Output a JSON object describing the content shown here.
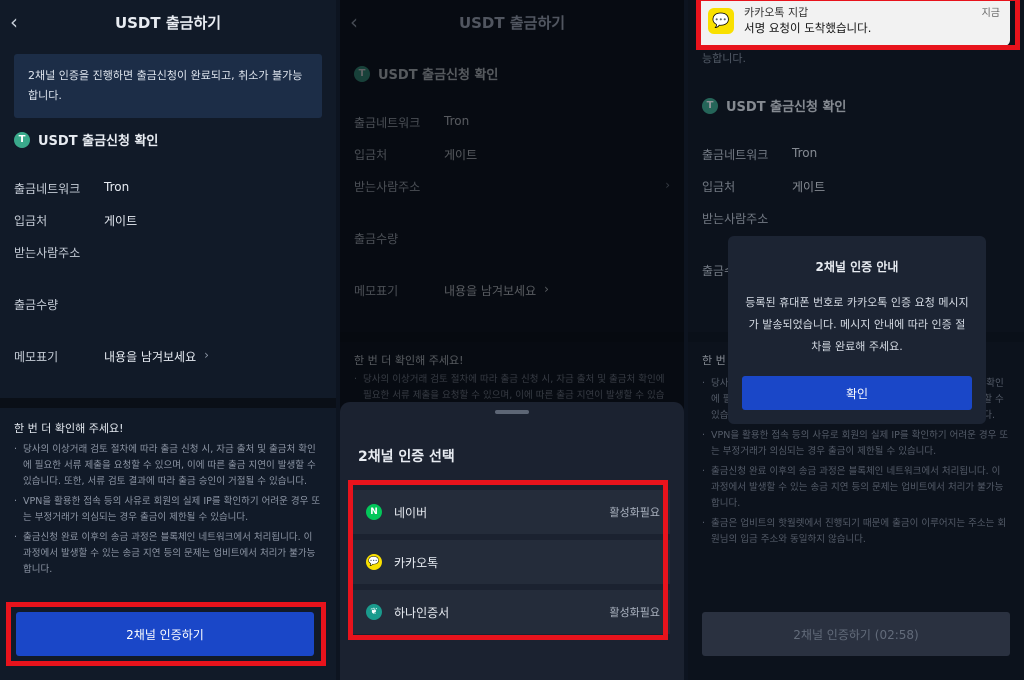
{
  "header": {
    "title": "USDT 출금하기",
    "back": "‹"
  },
  "notice": "2채널 인증을 진행하면 출금신청이 완료되고, 취소가 불가능합니다.",
  "notice_partial": "능합니다.",
  "section_title": "USDT 출금신청 확인",
  "token_symbol": "T",
  "fields": {
    "network_label": "출금네트워크",
    "network_value": "Tron",
    "dest_label": "입금처",
    "dest_value": "게이트",
    "address_label": "받는사람주소",
    "amount_label": "출금수량",
    "memo_label": "메모표기",
    "memo_value": "내용을 남겨보세요",
    "chevron": "›"
  },
  "check_title": "한 번 더 확인해 주세요!",
  "check_items": [
    "당사의 이상거래 검토 절차에 따라 출금 신청 시, 자금 출처 및 출금처 확인에 필요한 서류 제출을 요청할 수 있으며, 이에 따른 출금 지연이 발생할 수 있습니다. 또한, 서류 검토 결과에 따라 출금 승인이 거절될 수 있습니다.",
    "VPN을 활용한 접속 등의 사유로 회원의 실제 IP를 확인하기 어려운 경우 또는 부정거래가 의심되는 경우 출금이 제한될 수 있습니다.",
    "출금신청 완료 이후의 송금 과정은 블록체인 네트워크에서 처리됩니다. 이 과정에서 발생할 수 있는 송금 지연 등의 문제는 업비트에서 처리가 불가능합니다.",
    "출금은 업비트의 핫월렛에서 진행되기 때문에 출금이 이루어지는 주소는 회원님의 입금 주소와 동일하지 않습니다."
  ],
  "check_partial": "한 번",
  "p1_button": "2채널 인증하기",
  "sheet": {
    "title": "2채널 인증 선택",
    "options": [
      {
        "name": "네이버",
        "status": "활성화필요",
        "icon": "N",
        "color": "#03c75a"
      },
      {
        "name": "카카오톡",
        "status": "",
        "icon": "💬",
        "color": "#f9e000"
      },
      {
        "name": "하나인증서",
        "status": "활성화필요",
        "icon": "❦",
        "color": "#1a9b8d"
      }
    ]
  },
  "notification": {
    "title": "카카오톡 지갑",
    "message": "서명 요청이 도착했습니다.",
    "time": "지금"
  },
  "modal": {
    "title": "2채널 인증 안내",
    "body": "등록된 휴대폰 번호로 카카오톡 인증 요청 메시지가 발송되었습니다. 메시지 안내에 따라 인증 절차를 완료해 주세요.",
    "confirm": "확인"
  },
  "p3_button": "2채널 인증하기 (02:58)",
  "colors": {
    "accent": "#1a47c8",
    "highlight": "#e8131c",
    "bg": "#111a28"
  }
}
